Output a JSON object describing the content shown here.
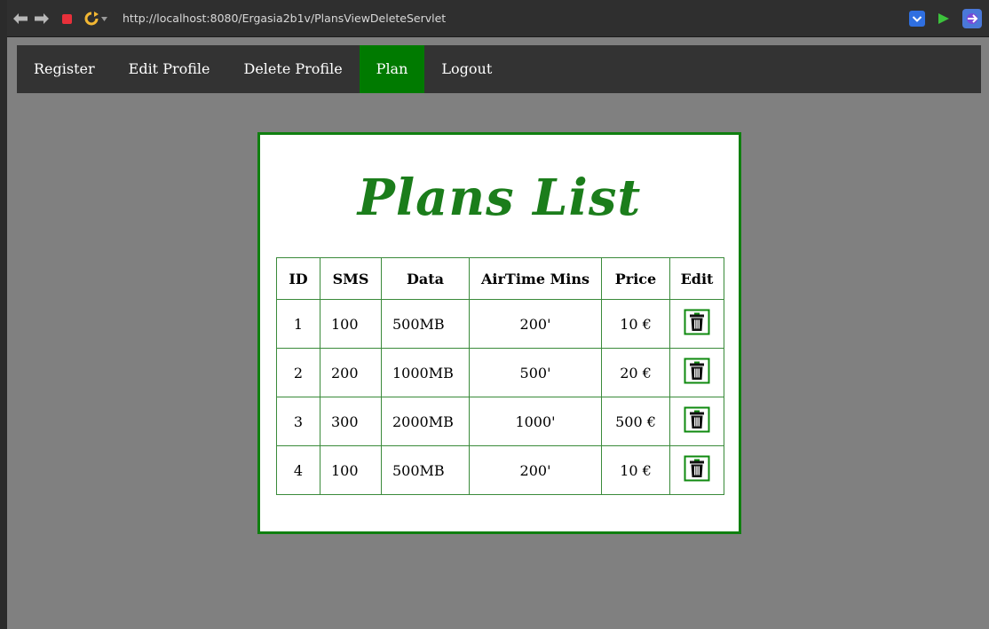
{
  "browser": {
    "url": "http://localhost:8080/Ergasia2b1v/PlansViewDeleteServlet"
  },
  "nav": {
    "items": [
      {
        "label": "Register",
        "active": false
      },
      {
        "label": "Edit Profile",
        "active": false
      },
      {
        "label": "Delete Profile",
        "active": false
      },
      {
        "label": "Plan",
        "active": true
      },
      {
        "label": "Logout",
        "active": false
      }
    ]
  },
  "card": {
    "title": "Plans List"
  },
  "table": {
    "headers": [
      "ID",
      "SMS",
      "Data",
      "AirTime Mins",
      "Price",
      "Edit"
    ],
    "rows": [
      {
        "id": "1",
        "sms": "100",
        "data": "500MB",
        "airtime": "200'",
        "price": "10 €",
        "edit_icon": "trash-icon"
      },
      {
        "id": "2",
        "sms": "200",
        "data": "1000MB",
        "airtime": "500'",
        "price": "20 €",
        "edit_icon": "trash-icon"
      },
      {
        "id": "3",
        "sms": "300",
        "data": "2000MB",
        "airtime": "1000'",
        "price": "500 €",
        "edit_icon": "trash-icon"
      },
      {
        "id": "4",
        "sms": "100",
        "data": "500MB",
        "airtime": "200'",
        "price": "10 €",
        "edit_icon": "trash-icon"
      }
    ]
  },
  "colors": {
    "accent": "#0f7f0f",
    "nav_bg": "#333333",
    "page_bg": "#808080"
  }
}
